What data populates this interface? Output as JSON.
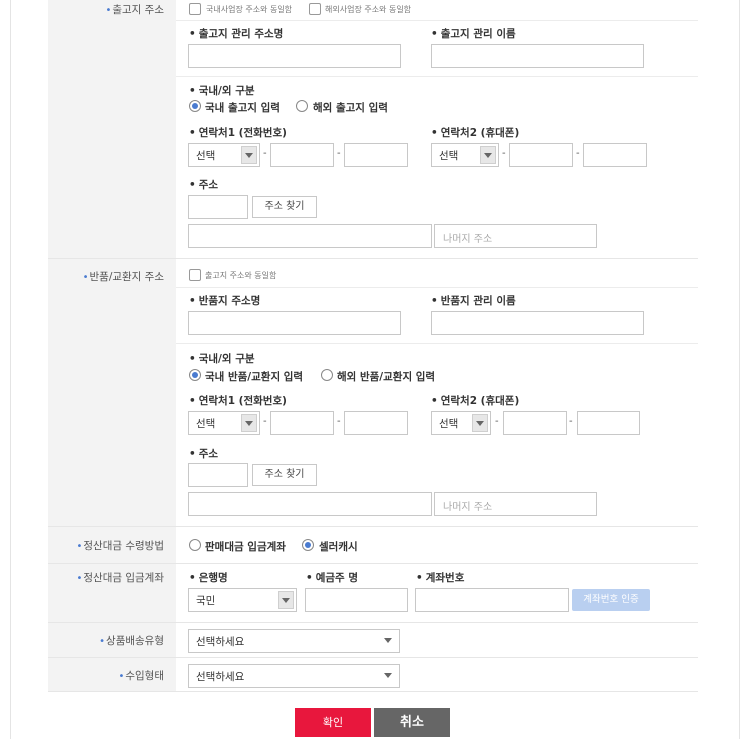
{
  "colors": {
    "accent": "#4a7bd0",
    "confirm": "#e8173d",
    "cancel": "#666666",
    "verify": "#b9cff0"
  },
  "shipping": {
    "row_label": "출고지 주소",
    "cb_domestic": "국내사업장 주소와 동일함",
    "cb_overseas": "해외사업장 주소와 동일함",
    "name_label": "출고지 관리 주소명",
    "manager_label": "출고지 관리 이름",
    "region_label": "국내/외 구분",
    "radio_domestic": "국내 출고지 입력",
    "radio_overseas": "해외 출고지 입력",
    "phone1_label": "연락처1 (전화번호)",
    "phone2_label": "연락처2 (휴대폰)",
    "select_value": "선택",
    "address_label": "주소",
    "find_address": "주소 찾기",
    "rest_address_placeholder": "나머지 주소"
  },
  "returns": {
    "row_label": "반품/교환지 주소",
    "cb_same": "출고지 주소와 동일함",
    "name_label": "반품지 주소명",
    "manager_label": "반품지 관리 이름",
    "region_label": "국내/외 구분",
    "radio_domestic": "국내 반품/교환지 입력",
    "radio_overseas": "해외 반품/교환지 입력",
    "phone1_label": "연락처1 (전화번호)",
    "phone2_label": "연락처2 (휴대폰)",
    "select_value": "선택",
    "address_label": "주소",
    "find_address": "주소 찾기",
    "rest_address_placeholder": "나머지 주소"
  },
  "settlement_method": {
    "row_label": "정산대금 수령방법",
    "option_account": "판매대금 입금계좌",
    "option_cash": "셀러캐시"
  },
  "settlement_account": {
    "row_label": "정산대금 입금계좌",
    "bank_label": "은행명",
    "holder_label": "예금주 명",
    "account_label": "계좌번호",
    "bank_value": "국민",
    "verify_button": "계좌번호 인증"
  },
  "delivery_type": {
    "row_label": "상품배송유형",
    "select_value": "선택하세요"
  },
  "import_type": {
    "row_label": "수입형태",
    "select_value": "선택하세요"
  },
  "actions": {
    "confirm": "확인",
    "cancel": "취소"
  }
}
